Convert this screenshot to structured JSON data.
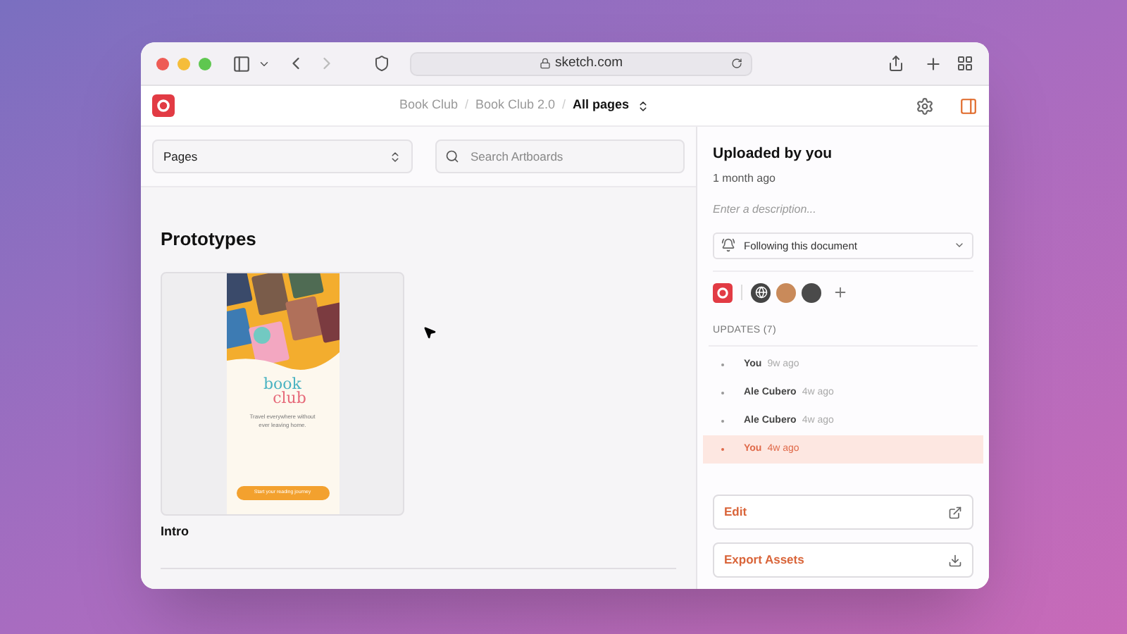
{
  "browser": {
    "url": "sketch.com"
  },
  "breadcrumb_separator": "/",
  "breadcrumbs": [
    {
      "label": "Book Club",
      "current": false
    },
    {
      "label": "Book Club 2.0",
      "current": false
    },
    {
      "label": "All pages",
      "current": true
    }
  ],
  "toolbar": {
    "pages_select": "Pages",
    "search": {
      "placeholder": "Search Artboards"
    }
  },
  "section": {
    "title": "Prototypes",
    "artboards": [
      {
        "name": "Intro",
        "preview": {
          "logo_top": "book",
          "logo_bottom": "club",
          "tagline": "Travel everywhere without ever leaving home.",
          "button": "Start your reading journey"
        }
      }
    ]
  },
  "sidebar": {
    "title": "Uploaded by you",
    "subtitle": "1 month ago",
    "description": {
      "placeholder": "Enter a description..."
    },
    "follow": "Following this document",
    "updates_heading": "UPDATES (7)",
    "updates": [
      {
        "name": "You",
        "time": "9w ago",
        "selected": false
      },
      {
        "name": "Ale Cubero",
        "time": "4w ago",
        "selected": false
      },
      {
        "name": "Ale Cubero",
        "time": "4w ago",
        "selected": false
      },
      {
        "name": "You",
        "time": "4w ago",
        "selected": true
      }
    ],
    "actions": [
      {
        "label": "Edit",
        "kind": "external"
      },
      {
        "label": "Export Assets",
        "kind": "download"
      }
    ]
  }
}
